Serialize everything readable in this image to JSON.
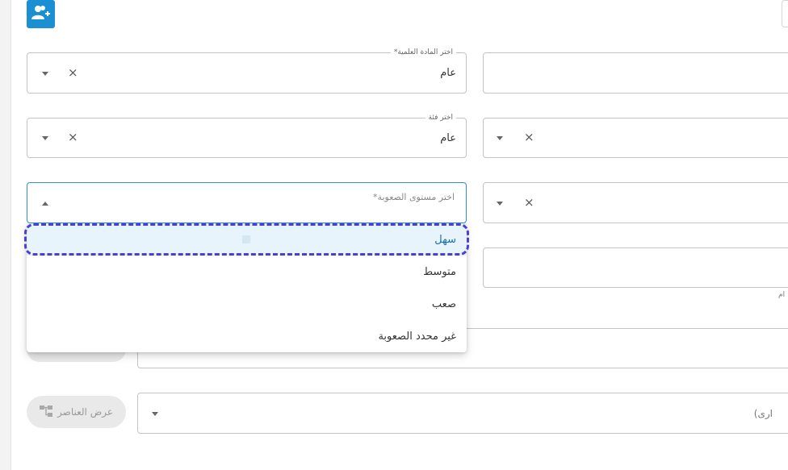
{
  "header": {
    "add_user_icon": "add-user-icon"
  },
  "subject": {
    "label": "اختر المادة العلمية*",
    "value": "عام"
  },
  "category": {
    "label": "اختر فئة",
    "value": "عام"
  },
  "difficulty": {
    "placeholder": "اختر مستوى الصعوبة*",
    "options": [
      "سهل",
      "متوسط",
      "صعب",
      "غير محدد الصعوبة"
    ],
    "highlighted": "سهل"
  },
  "right_hint": "ام",
  "bottom_right_field": {
    "partial_text": "ارى)"
  },
  "view_elements_button": {
    "label": "عرض العناصر"
  }
}
